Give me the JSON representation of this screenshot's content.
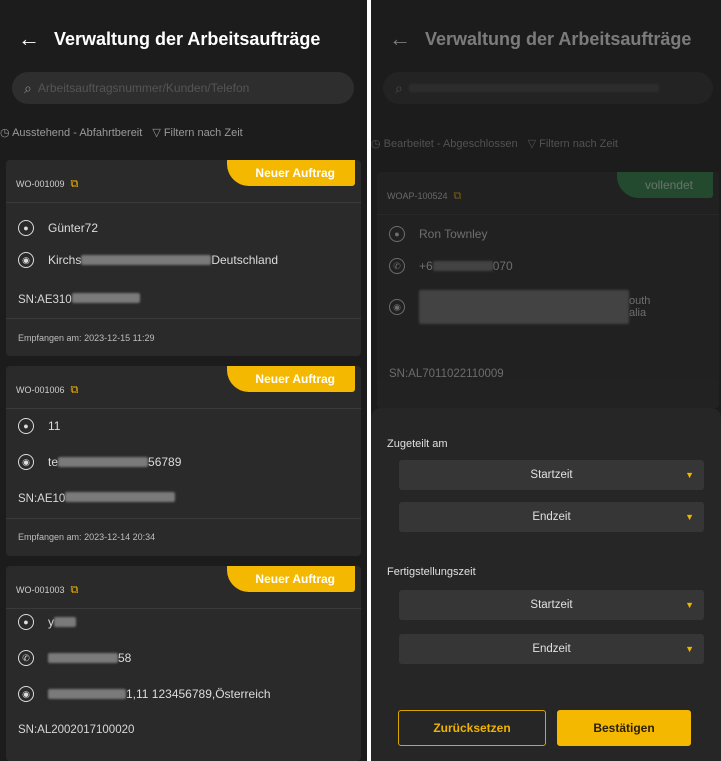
{
  "left": {
    "title": "Verwaltung der Arbeitsaufträge",
    "search_placeholder": "Arbeitsauftragsnummer/Kunden/Telefon",
    "filter_status": "Ausstehend - Abfahrtbereit",
    "filter_time": "Filtern nach Zeit",
    "cards": [
      {
        "id": "WO-001009",
        "badge": "Neuer Auftrag",
        "name": "Günter72",
        "address_a": "Kirchs",
        "address_b": "Deutschland",
        "sn": "SN:AE310",
        "received_label": "Empfangen am:",
        "received": "2023-12-15 11:29"
      },
      {
        "id": "WO-001006",
        "badge": "Neuer Auftrag",
        "name": "11",
        "address_a": "te",
        "address_b": "56789",
        "sn": "SN:AE10",
        "received_label": "Empfangen am:",
        "received": "2023-12-14 20:34"
      },
      {
        "id": "WO-001003",
        "badge": "Neuer Auftrag",
        "name": "y",
        "phone": "58",
        "address": "1,11 123456789,Österreich",
        "sn": "SN:AL2002017100020"
      }
    ]
  },
  "right": {
    "title": "Verwaltung der Arbeitsaufträge",
    "filter_status": "Bearbeitet - Abgeschlossen",
    "filter_time": "Filtern nach Zeit",
    "card": {
      "id": "WOAP-100524",
      "badge": "vollendet",
      "name": "Ron Townley",
      "phone_a": "+6",
      "phone_b": "070",
      "addr_a": "outh",
      "addr_b": "alia",
      "sn": "SN:AL7011022110009"
    },
    "sheet": {
      "assigned_label": "Zugeteilt am",
      "completion_label": "Fertigstellungszeit",
      "start": "Startzeit",
      "end": "Endzeit",
      "reset": "Zurücksetzen",
      "confirm": "Bestätigen"
    }
  },
  "colors": {
    "accent": "#f5b800",
    "complete": "#2e8b4a",
    "background": "#1c1c1c",
    "card": "#2a2a2a"
  }
}
